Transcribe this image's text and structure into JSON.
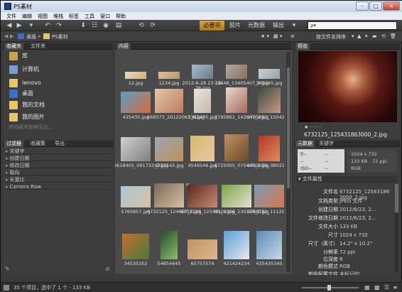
{
  "window": {
    "title": "PS素材",
    "minimize": "–",
    "maximize": "□",
    "close": "×"
  },
  "menu": [
    "文件",
    "编辑",
    "视图",
    "堆栈",
    "标签",
    "工具",
    "窗口",
    "帮助"
  ],
  "toolbar": {
    "active_workspace": "必要项",
    "workspaces": [
      "胶片",
      "元数据",
      "输出"
    ],
    "search_placeholder": "ρ▾"
  },
  "path": {
    "items": [
      "桌面",
      "PS素材"
    ],
    "sort": "按文件名排序"
  },
  "favorites": {
    "tabs": [
      "收藏夹",
      "文件夹"
    ],
    "items": [
      {
        "label": "库",
        "color": "#c9a34a"
      },
      {
        "label": "计算机",
        "color": "#7b9ccf"
      },
      {
        "label": "lenovo",
        "color": "#e6c66a"
      },
      {
        "label": "桌面",
        "color": "#3a6fc4"
      },
      {
        "label": "我的文档",
        "color": "#e6c66a"
      },
      {
        "label": "我的图片",
        "color": "#e6c66a"
      }
    ],
    "hint": "将收藏夹拖移至此..."
  },
  "filter": {
    "tabs": [
      "过滤器",
      "收藏集",
      "导出"
    ],
    "items": [
      "关键字",
      "创建日期",
      "修改日期",
      "取向",
      "长宽比",
      "Camera Raw"
    ]
  },
  "content": {
    "tab": "内容",
    "thumbs": [
      {
        "label": "12.jpg",
        "colors": [
          "#e8d8c0",
          "#d4b27a"
        ]
      },
      {
        "label": "1234.jpg",
        "colors": [
          "#d8c4a0",
          "#b99462"
        ]
      },
      {
        "label": "2012-6-28 23-16-28.jpg",
        "colors": [
          "#a8b8c8",
          "#6a7a8a"
        ]
      },
      {
        "label": "73648_13405407_2.jpg",
        "colors": [
          "#b0a8a0",
          "#8a7058"
        ]
      },
      {
        "label": "345345.jpg",
        "colors": [
          "#c8d0d8",
          "#98a0a8"
        ]
      },
      {
        "label": "435435.jpg",
        "colors": [
          "#5aa0c8",
          "#d86a3a"
        ]
      },
      {
        "label": "668573_20122061_6.jpg",
        "colors": [
          "#e0c8b0",
          "#c07a5a"
        ]
      },
      {
        "label": "2345435.jpg",
        "colors": [
          "#e8e4e0",
          "#c8b8a8"
        ]
      },
      {
        "label": "2795861_142647_2.jpg",
        "colors": [
          "#e8d8d0",
          "#a86a58"
        ]
      },
      {
        "label": "2795861_150420_2.jpg",
        "colors": [
          "#3a4a3a",
          "#c89a88"
        ]
      },
      {
        "label": "3618405_091733_2.jpg",
        "colors": [
          "#d0d0d0",
          "#808080"
        ]
      },
      {
        "label": "4353545.jpg",
        "colors": [
          "#98a8b0",
          "#c0905a"
        ]
      },
      {
        "label": "4546546.jpg",
        "colors": [
          "#d8b870",
          "#e8c8a0"
        ]
      },
      {
        "label": "6725005_075446_2.jpg",
        "colors": [
          "#c09060",
          "#6a4a2a"
        ]
      },
      {
        "label": "6730005_080212_2.jpg",
        "colors": [
          "#b03a2a",
          "#e08a5a"
        ]
      },
      {
        "label": "5765857.jpg",
        "colors": [
          "#a8c8d8",
          "#d8c0a0"
        ]
      },
      {
        "label": "6732125_124607_2.jpg",
        "colors": [
          "#7a6a5a",
          "#d8c0a0"
        ]
      },
      {
        "label": "6732125_125431_2.jpg",
        "colors": [
          "#5a2a20",
          "#c88a70"
        ]
      },
      {
        "label": "8520906_130119_2.jpg",
        "colors": [
          "#78a848",
          "#e8e0d0"
        ]
      },
      {
        "label": "9768761_111206_2.jpg",
        "colors": [
          "#7a9ab8",
          "#d87848"
        ]
      },
      {
        "label": "34535352",
        "colors": [
          "#c07030",
          "#4a7a3a"
        ]
      },
      {
        "label": "54654645",
        "colors": [
          "#2a4a2a",
          "#8ac06a"
        ]
      },
      {
        "label": "65757574",
        "colors": [
          "#c09060",
          "#e0b890"
        ]
      },
      {
        "label": "421424234",
        "colors": [
          "#58a0d8",
          "#e8e8f0"
        ]
      },
      {
        "label": "435435345",
        "colors": [
          "#5a8ab8",
          "#c8d8e8"
        ]
      }
    ]
  },
  "preview": {
    "tab": "预览",
    "filename": "6732125_125431863000_2.jpg",
    "stars": "★ · · · ·"
  },
  "metadata": {
    "tabs": [
      "元数据",
      "关键字"
    ],
    "camera": [
      "f/--",
      "--",
      "--",
      "--",
      "ISO--",
      "--"
    ],
    "summary": [
      "1024 x 732",
      "133 KB",
      "72 ppi",
      "RGB"
    ],
    "section": "文件属性",
    "rows": [
      {
        "k": "文件名",
        "v": "6732125_125431863000_2.jpg"
      },
      {
        "k": "文档类型",
        "v": "JPEG 文件"
      },
      {
        "k": "创建日期",
        "v": "2012/6/23, 2..."
      },
      {
        "k": "文件修改日期",
        "v": "2012/6/23, 2..."
      },
      {
        "k": "文件大小",
        "v": "133 KB"
      },
      {
        "k": "尺寸",
        "v": "1024 x 732"
      },
      {
        "k": "尺寸（英寸）",
        "v": "14.2\" x 10.2\""
      },
      {
        "k": "分辨率",
        "v": "72 ppi"
      },
      {
        "k": "位深度",
        "v": "8"
      },
      {
        "k": "颜色模式",
        "v": "RGB"
      },
      {
        "k": "颜色配置文件",
        "v": "未标记的"
      }
    ]
  },
  "status": {
    "text": "35 个项目，选中了 1 个 - 133 KB"
  }
}
